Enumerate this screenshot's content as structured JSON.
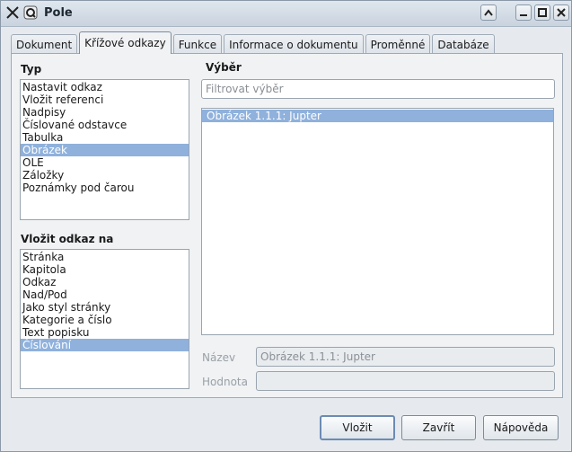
{
  "window": {
    "title": "Pole"
  },
  "titlebar": {
    "icons": [
      "tools-icon",
      "pin-icon"
    ],
    "buttons": [
      "up-icon",
      "minimize-icon",
      "maximize-icon",
      "close-icon"
    ]
  },
  "tabs": [
    "Dokument",
    "Křížové odkazy",
    "Funkce",
    "Informace o dokumentu",
    "Proměnné",
    "Databáze"
  ],
  "active_tab": "Křížové odkazy",
  "type_section": {
    "label": "Typ",
    "items": [
      "Nastavit odkaz",
      "Vložit referenci",
      "Nadpisy",
      "Číslované odstavce",
      "Tabulka",
      "Obrázek",
      "OLE",
      "Záložky",
      "Poznámky pod čarou"
    ],
    "selected": "Obrázek"
  },
  "insert_ref_section": {
    "label": "Vložit odkaz na",
    "items": [
      "Stránka",
      "Kapitola",
      "Odkaz",
      "Nad/Pod",
      "Jako styl stránky",
      "Kategorie a číslo",
      "Text popisku",
      "Číslování"
    ],
    "selected": "Číslování"
  },
  "selection_section": {
    "label": "Výběr",
    "filter_placeholder": "Filtrovat výběr",
    "items": [
      "Obrázek 1.1.1: Jupter"
    ],
    "selected": "Obrázek 1.1.1: Jupter"
  },
  "fields": {
    "name_label": "Název",
    "name_value": "Obrázek 1.1.1: Jupter",
    "value_label": "Hodnota",
    "value_value": ""
  },
  "buttons": {
    "insert": "Vložit",
    "close": "Zavřít",
    "help": "Nápověda"
  }
}
